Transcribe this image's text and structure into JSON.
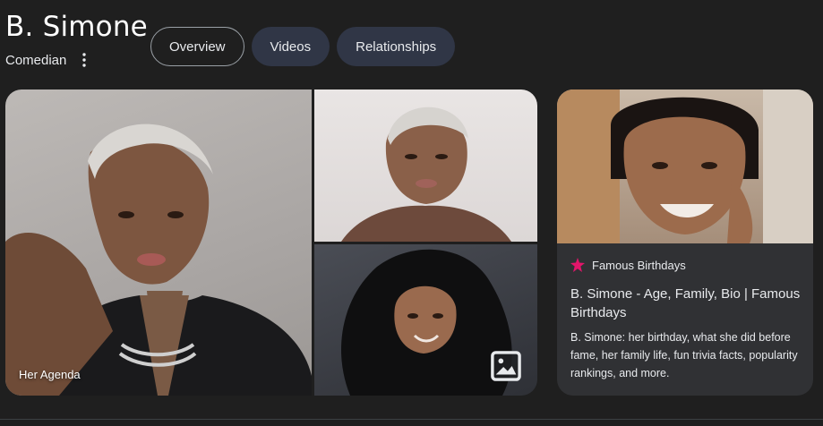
{
  "entity": {
    "name": "B. Simone",
    "subtitle": "Comedian"
  },
  "tabs": [
    {
      "label": "Overview",
      "active": true
    },
    {
      "label": "Videos",
      "active": false
    },
    {
      "label": "Relationships",
      "active": false
    }
  ],
  "gallery": {
    "main_image_source": "Her Agenda"
  },
  "result_card": {
    "source_name": "Famous Birthdays",
    "title": "B. Simone - Age, Family, Bio | Famous Birthdays",
    "snippet": "B. Simone: her birthday, what she did before fame, her family life, fun trivia facts, popularity rankings, and more."
  },
  "colors": {
    "background": "#1f1f1f",
    "tab_background": "#303646",
    "card_background": "#303134",
    "favicon_accent": "#e3156b"
  }
}
